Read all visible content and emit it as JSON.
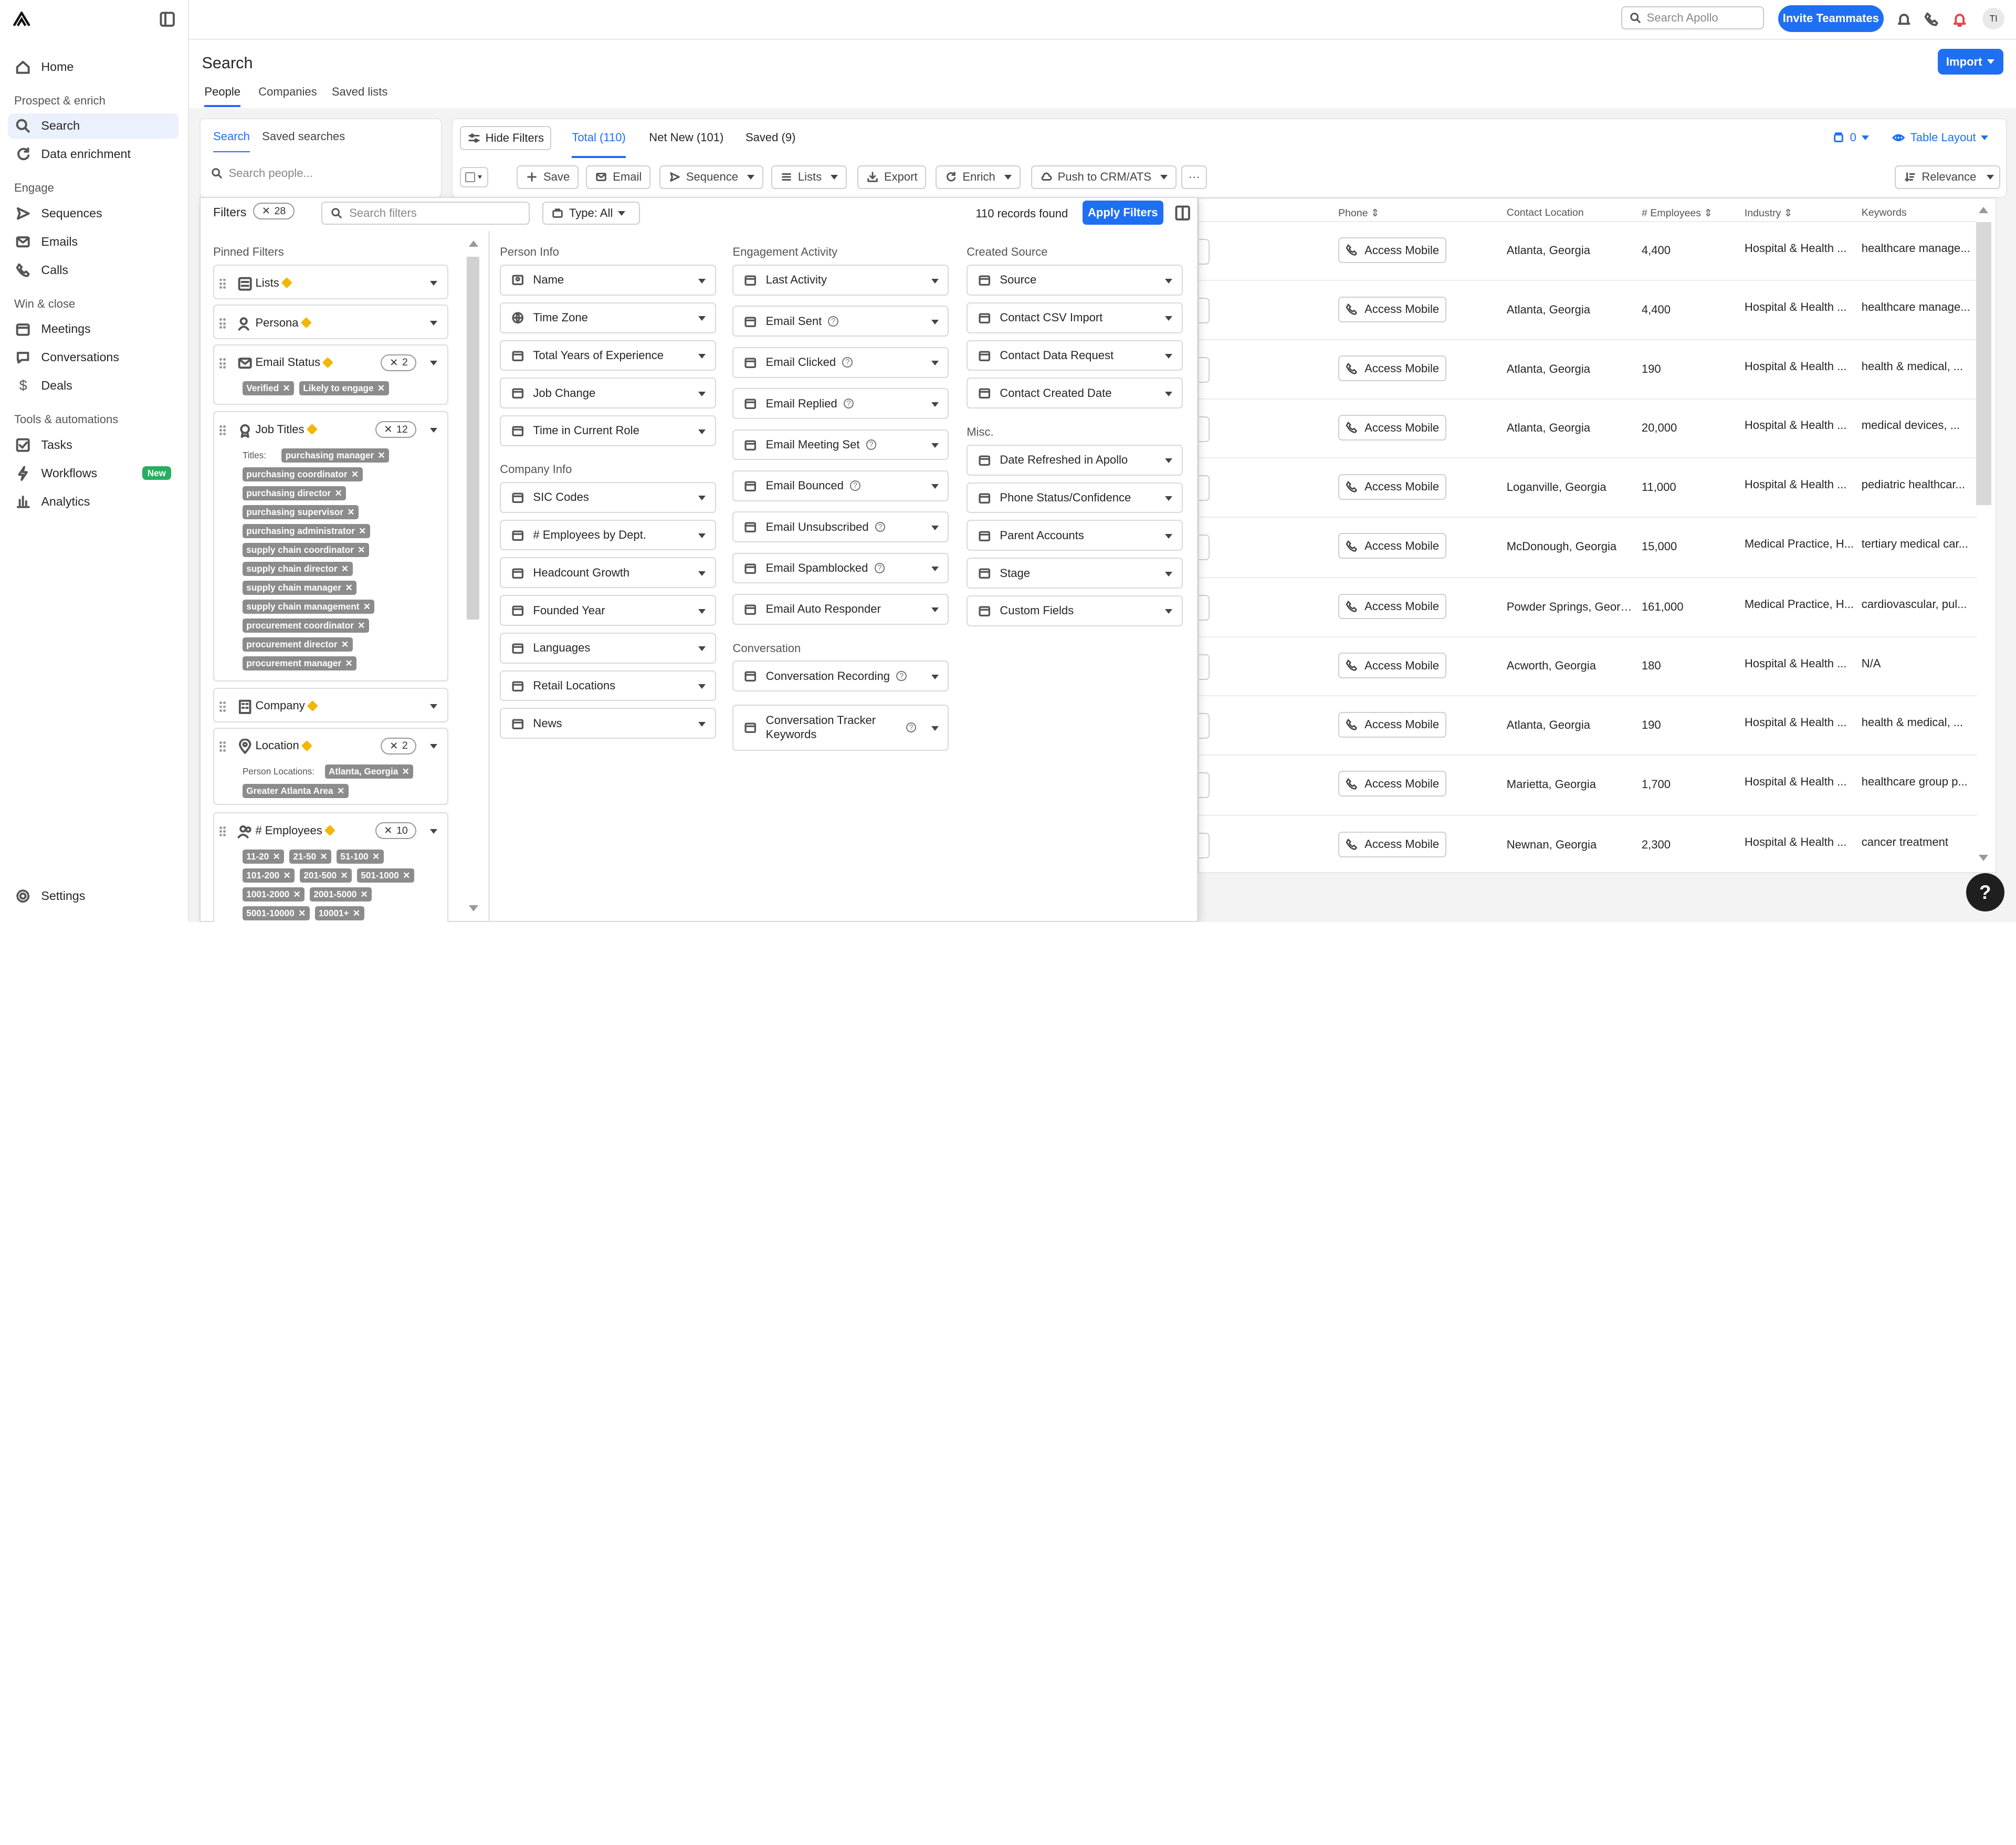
{
  "sidebar": {
    "sections": {
      "prospect": "Prospect & enrich",
      "engage": "Engage",
      "win": "Win & close",
      "tools": "Tools & automations"
    },
    "items": {
      "home": "Home",
      "search": "Search",
      "enrichment": "Data enrichment",
      "sequences": "Sequences",
      "emails": "Emails",
      "calls": "Calls",
      "meetings": "Meetings",
      "conversations": "Conversations",
      "deals": "Deals",
      "tasks": "Tasks",
      "workflows": "Workflows",
      "analytics": "Analytics",
      "settings": "Settings"
    },
    "workflows_badge": "New"
  },
  "header": {
    "search_placeholder": "Search Apollo",
    "invite": "Invite Teammates",
    "avatar": "TI"
  },
  "page": {
    "title": "Search",
    "tabs": [
      "People",
      "Companies",
      "Saved lists"
    ],
    "import": "Import"
  },
  "left_panel": {
    "tabs": [
      "Search",
      "Saved searches"
    ],
    "search_placeholder": "Search people..."
  },
  "toolbar": {
    "hide_filters": "Hide Filters",
    "views": [
      "Total (110)",
      "Net New (101)",
      "Saved (9)"
    ],
    "list_count": "0",
    "table_layout": "Table Layout",
    "actions": {
      "save": "Save",
      "email": "Email",
      "sequence": "Sequence",
      "lists": "Lists",
      "export": "Export",
      "enrich": "Enrich",
      "push": "Push to CRM/ATS",
      "more": "···"
    },
    "sort": "Relevance"
  },
  "filters": {
    "title": "Filters",
    "count": "28",
    "search_placeholder": "Search filters",
    "type": "Type: All",
    "records": "110 records found",
    "apply": "Apply Filters",
    "pinned_title": "Pinned Filters",
    "pinned": {
      "lists": "Lists",
      "persona": "Persona",
      "email_status": {
        "label": "Email Status",
        "count": "2",
        "chips": [
          "Verified",
          "Likely to engage"
        ]
      },
      "job_titles": {
        "label": "Job Titles",
        "count": "12",
        "sub": "Titles:",
        "chips": [
          "purchasing manager",
          "purchasing coordinator",
          "purchasing director",
          "purchasing supervisor",
          "purchasing administrator",
          "supply chain coordinator",
          "supply chain director",
          "supply chain manager",
          "supply chain management",
          "procurement coordinator",
          "procurement director",
          "procurement manager"
        ]
      },
      "company": "Company",
      "location": {
        "label": "Location",
        "count": "2",
        "sub": "Person Locations:",
        "chips": [
          "Atlanta, Georgia",
          "Greater Atlanta Area"
        ]
      },
      "employees": {
        "label": "# Employees",
        "count": "10",
        "chips": [
          "11-20",
          "21-50",
          "51-100",
          "101-200",
          "201-500",
          "501-1000",
          "1001-2000",
          "2001-5000",
          "5001-10000",
          "10001+"
        ]
      }
    },
    "columns": {
      "person_info": {
        "title": "Person Info",
        "items": [
          "Name",
          "Time Zone",
          "Total Years of Experience",
          "Job Change",
          "Time in Current Role"
        ]
      },
      "company_info": {
        "title": "Company Info",
        "items": [
          "SIC Codes",
          "# Employees by Dept.",
          "Headcount Growth",
          "Founded Year",
          "Languages",
          "Retail Locations",
          "News"
        ]
      },
      "engagement": {
        "title": "Engagement Activity",
        "items": [
          "Last Activity",
          "Email Sent",
          "Email Clicked",
          "Email Replied",
          "Email Meeting Set",
          "Email Bounced",
          "Email Unsubscribed",
          "Email Spamblocked",
          "Email Auto Responder"
        ]
      },
      "conversation": {
        "title": "Conversation",
        "items": [
          "Conversation Recording",
          "Conversation Tracker Keywords"
        ]
      },
      "created_source": {
        "title": "Created Source",
        "items": [
          "Source",
          "Contact CSV Import",
          "Contact Data Request",
          "Contact Created Date"
        ]
      },
      "misc": {
        "title": "Misc.",
        "items": [
          "Date Refreshed in Apollo",
          "Phone Status/Confidence",
          "Parent Accounts",
          "Stage",
          "Custom Fields"
        ]
      }
    }
  },
  "table": {
    "headers": {
      "phone": "Phone",
      "location": "Contact Location",
      "employees": "# Employees",
      "industry": "Industry",
      "keywords": "Keywords"
    },
    "access_label": "Access Mobile",
    "rows": [
      {
        "location": "Atlanta, Georgia",
        "employees": "4,400",
        "industry": "Hospital & Health ...",
        "keywords": "healthcare manage..."
      },
      {
        "location": "Atlanta, Georgia",
        "employees": "4,400",
        "industry": "Hospital & Health ...",
        "keywords": "healthcare manage..."
      },
      {
        "location": "Atlanta, Georgia",
        "employees": "190",
        "industry": "Hospital & Health ...",
        "keywords": "health & medical, ..."
      },
      {
        "location": "Atlanta, Georgia",
        "employees": "20,000",
        "industry": "Hospital & Health ...",
        "keywords": "medical devices, ..."
      },
      {
        "location": "Loganville, Georgia",
        "employees": "11,000",
        "industry": "Hospital & Health ...",
        "keywords": "pediatric healthcar..."
      },
      {
        "location": "McDonough, Georgia",
        "employees": "15,000",
        "industry": "Medical Practice, H...",
        "keywords": "tertiary medical car..."
      },
      {
        "location": "Powder Springs, Georgia",
        "employees": "161,000",
        "industry": "Medical Practice, H...",
        "keywords": "cardiovascular,  pul..."
      },
      {
        "location": "Acworth, Georgia",
        "employees": "180",
        "industry": "Hospital & Health ...",
        "keywords": "N/A"
      },
      {
        "location": "Atlanta, Georgia",
        "employees": "190",
        "industry": "Hospital & Health ...",
        "keywords": "health & medical, ..."
      },
      {
        "location": "Marietta, Georgia",
        "employees": "1,700",
        "industry": "Hospital & Health ...",
        "keywords": "healthcare group p..."
      },
      {
        "location": "Newnan, Georgia",
        "employees": "2,300",
        "industry": "Hospital & Health ...",
        "keywords": "cancer treatment"
      }
    ]
  },
  "help": "?"
}
